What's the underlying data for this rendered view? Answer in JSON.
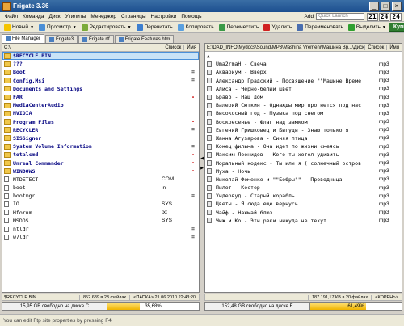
{
  "window": {
    "title": "Frigate 3.36",
    "min": "_",
    "max": "□",
    "close": "×"
  },
  "menu": {
    "items": [
      "Файл",
      "Команда",
      "Диск",
      "Утилиты",
      "Менеджер",
      "Страницы",
      "Настройки",
      "Помощь"
    ],
    "add": "Add",
    "quick_launch_placeholder": "Quick Launch",
    "time": [
      "21",
      "24",
      "24"
    ]
  },
  "toolbar": {
    "new": "Новый",
    "view": "Просмотр",
    "edit": "Редактировать",
    "print": "Перечитать",
    "copy": "Копировать",
    "move": "Переместить",
    "delete": "Удалить",
    "rename": "Переименовать",
    "select": "Выделить",
    "go": "Купить"
  },
  "tabs": [
    "File Manager",
    "Frigate3",
    "Frigate.rtf",
    "Frigate Features.htm"
  ],
  "left": {
    "path": "C:\\",
    "list_label": "Список",
    "sort_label": "Имя",
    "rows": [
      {
        "name": "$RECYCLE.BIN",
        "ext": "",
        "attr": "",
        "type": "folder",
        "sel": true
      },
      {
        "name": "???",
        "ext": "",
        "attr": "",
        "type": "folder"
      },
      {
        "name": "Boot",
        "ext": "",
        "attr": "=",
        "type": "folder"
      },
      {
        "name": "Config.Msi",
        "ext": "",
        "attr": "=",
        "type": "folder"
      },
      {
        "name": "Documents and Settings",
        "ext": "",
        "attr": "",
        "type": "folder"
      },
      {
        "name": "FAR",
        "ext": "",
        "attr": "•",
        "type": "folder"
      },
      {
        "name": "MediaCenterAudio",
        "ext": "",
        "attr": "",
        "type": "folder"
      },
      {
        "name": "NVIDIA",
        "ext": "",
        "attr": "",
        "type": "folder"
      },
      {
        "name": "Program Files",
        "ext": "",
        "attr": "•",
        "type": "folder"
      },
      {
        "name": "RECYCLER",
        "ext": "",
        "attr": "=",
        "type": "folder"
      },
      {
        "name": "SISSigner",
        "ext": "",
        "attr": "",
        "type": "folder"
      },
      {
        "name": "System Volume Information",
        "ext": "",
        "attr": "=",
        "type": "folder"
      },
      {
        "name": "totalcmd",
        "ext": "",
        "attr": "•",
        "type": "folder"
      },
      {
        "name": "Unreal Commander",
        "ext": "",
        "attr": "•",
        "type": "folder"
      },
      {
        "name": "WINDOWS",
        "ext": "",
        "attr": "•",
        "type": "folder"
      },
      {
        "name": "NTDETECT",
        "ext": "COM",
        "attr": "",
        "type": "file"
      },
      {
        "name": "boot",
        "ext": "ini",
        "attr": "",
        "type": "file"
      },
      {
        "name": "bootmgr",
        "ext": "",
        "attr": "=",
        "type": "file"
      },
      {
        "name": "IO",
        "ext": "SYS",
        "attr": "",
        "type": "file"
      },
      {
        "name": "Hforum",
        "ext": "txt",
        "attr": "",
        "type": "file"
      },
      {
        "name": "MSDOS",
        "ext": "SYS",
        "attr": "",
        "type": "file"
      },
      {
        "name": "ntldr",
        "ext": "",
        "attr": "=",
        "type": "file"
      },
      {
        "name": "w7ldr",
        "ext": "",
        "attr": "=",
        "type": "file"
      }
    ],
    "status_name": "$RECYCLE.BIN",
    "status_size": "852.689 в 23 файлах",
    "status_type": "<ПАПКА> 21.06.2010 22:43:20",
    "disk_text": "15,95 GB свободно на диске C",
    "disk_pct": "35,68%",
    "disk_fraction": 0.3568
  },
  "right": {
    "path": "E:\\DAD_INFO\\Mydocs\\Sound\\MP3\\Mashina Vremeni\\Машина Вр...\\Диск -...",
    "list_label": "Список",
    "sort_label": "Имя",
    "rows": [
      {
        "name": "..",
        "ext": "",
        "type": "up"
      },
      {
        "name": "Uma2rmaH - Свеча",
        "ext": "mp3",
        "type": "mp3"
      },
      {
        "name": "Аквариум - Вверх",
        "ext": "mp3",
        "type": "mp3"
      },
      {
        "name": "Александр Градский - Посвящение \"\"Машине Времени\"\"",
        "ext": "mp3",
        "type": "mp3"
      },
      {
        "name": "Алиса - Чёрно-белый цвет",
        "ext": "mp3",
        "type": "mp3"
      },
      {
        "name": "Браво - Наш дом",
        "ext": "mp3",
        "type": "mp3"
      },
      {
        "name": "Валерий Сюткин - Однажды мир прогнется под нас",
        "ext": "mp3",
        "type": "mp3"
      },
      {
        "name": "Високосный год - Музыка под снегом",
        "ext": "mp3",
        "type": "mp3"
      },
      {
        "name": "Воскресенье - Флаг над замком",
        "ext": "mp3",
        "type": "mp3"
      },
      {
        "name": "Евгений Гришковец и Бигуди - Знаю только я",
        "ext": "mp3",
        "type": "mp3"
      },
      {
        "name": "Жанна Агузарова - Синяя птица",
        "ext": "mp3",
        "type": "mp3"
      },
      {
        "name": "Конец фильма - Она идет по жизни смеясь",
        "ext": "mp3",
        "type": "mp3"
      },
      {
        "name": "Максим Леонидов - Кого ты хотел удивить",
        "ext": "mp3",
        "type": "mp3"
      },
      {
        "name": "Моральный кодекс - Ты или я ( солнечный остров)",
        "ext": "mp3",
        "type": "mp3"
      },
      {
        "name": "Муха - Ночь",
        "ext": "mp3",
        "type": "mp3"
      },
      {
        "name": "Николай Фоменко и \"\"Бобры\"\" - Проводница",
        "ext": "mp3",
        "type": "mp3"
      },
      {
        "name": "Пилот - Костер",
        "ext": "mp3",
        "type": "mp3"
      },
      {
        "name": "Ундервуд - Старый корабль",
        "ext": "mp3",
        "type": "mp3"
      },
      {
        "name": "Цветы - Я сюда еще вернусь",
        "ext": "mp3",
        "type": "mp3"
      },
      {
        "name": "Чайф - Нажмай блюз",
        "ext": "mp3",
        "type": "mp3"
      },
      {
        "name": "Чиж и Ко - Эти реки никуда не текут",
        "ext": "mp3",
        "type": "mp3"
      }
    ],
    "status_name": "..",
    "status_size": "187 191,17 КВ в 20 файлах",
    "status_type": "<КОРЕНЬ>",
    "disk_text": "152,48 GB свободно на диске E",
    "disk_pct": "61,49%",
    "disk_fraction": 0.6149
  },
  "footer": {
    "hint": "You can edit Ftp site properties by pressing F4"
  }
}
